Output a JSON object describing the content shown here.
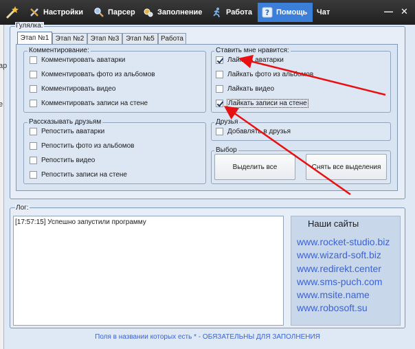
{
  "topbar": {
    "tabs": [
      {
        "label": "Настройки",
        "icon": "wrench-icon"
      },
      {
        "label": "Парсер",
        "icon": "magnifier-icon"
      },
      {
        "label": "Заполнение",
        "icon": "gears-icon"
      },
      {
        "label": "Работа",
        "icon": "runner-icon"
      },
      {
        "label": "Помощь",
        "icon": "question-icon"
      },
      {
        "label": "Чат",
        "icon": ""
      }
    ],
    "active_tab": "Помощь",
    "minimize": "—",
    "close": "✕"
  },
  "side_clip": [
    "ар",
    "е"
  ],
  "walker": {
    "legend": "Гулялка:",
    "stages": [
      "Этап №1",
      "Этап №2",
      "Этап №3",
      "Этап №5",
      "Работа"
    ],
    "active_stage": "Этап №1",
    "comment": {
      "title": "Комментирование:",
      "items": [
        {
          "label": "Комментировать аватарки",
          "checked": false
        },
        {
          "label": "Комментировать фото из альбомов",
          "checked": false
        },
        {
          "label": "Комментировать видео",
          "checked": false
        },
        {
          "label": "Комментировать записи на стене",
          "checked": false
        }
      ]
    },
    "like": {
      "title": "Ставить мне нравится:",
      "items": [
        {
          "label": "Лайкать аватарки",
          "checked": true
        },
        {
          "label": "Лайкать фото из альбомов",
          "checked": false
        },
        {
          "label": "Лайкать видео",
          "checked": false
        },
        {
          "label": "Лайкать записи на стене",
          "checked": true
        }
      ]
    },
    "repost": {
      "title": "Рассказывать друзьям",
      "items": [
        {
          "label": "Репостить аватарки",
          "checked": false
        },
        {
          "label": "Репостить  фото из альбомов",
          "checked": false
        },
        {
          "label": "Репостить  видео",
          "checked": false
        },
        {
          "label": "Репостить  записи на стене",
          "checked": false
        }
      ]
    },
    "friends": {
      "title": "Друзья",
      "items": [
        {
          "label": "Добавлять в друзья",
          "checked": false
        }
      ]
    },
    "select": {
      "title": "Выбор",
      "select_all": "Выделить все",
      "clear_all": "Снять все выделения"
    }
  },
  "log": {
    "legend": "Лог:",
    "lines": [
      "[17:57:15] Успешно запустили программу"
    ]
  },
  "sites": {
    "title": "Наши сайты",
    "links": [
      "www.rocket-studio.biz",
      "www.wizard-soft.biz",
      "www.redirekt.center",
      "www.sms-puch.com",
      "www.msite.name",
      "www.robosoft.su"
    ]
  },
  "footer": "Поля в названии которых есть * - ОБЯЗАТЕЛЬНЫ ДЛЯ ЗАПОЛНЕНИЯ",
  "colors": {
    "accent": "#3b7fd9",
    "link": "#3a63d6",
    "arrow": "#e81010",
    "topbar": "#262626"
  }
}
